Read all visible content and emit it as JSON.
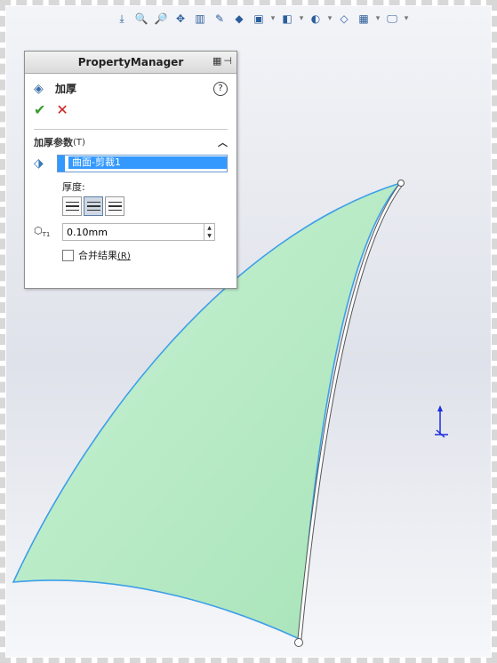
{
  "property_manager": {
    "title": "PropertyManager",
    "feature_name": "加厚",
    "help_glyph": "?",
    "ok_glyph": "✔",
    "cancel_glyph": "✕",
    "group_title": "加厚参数",
    "group_shortcut": "(T)",
    "selection_item": "曲面-剪裁1",
    "thickness_label": "厚度:",
    "thickness_value": "0.10mm",
    "thickness_icon_label": "T1",
    "merge_label": "合并结果",
    "merge_shortcut": "(R)",
    "merge_checked": false,
    "active_direction": 2
  },
  "toolbar_icons": [
    "view-orient-icon",
    "zoom-fit-icon",
    "zoom-area-icon",
    "pan-icon",
    "section-view-icon",
    "render-tools-icon",
    "display-style-icon",
    "view-setting-icon",
    "hide-show-icon",
    "appearance-icon",
    "scene-icon",
    "monitor-icon"
  ],
  "colors": {
    "surface_fill": "#b6ebc6",
    "surface_edge": "#3d9fe8",
    "selection": "#3399ff",
    "triad": "#1f2ee0"
  }
}
